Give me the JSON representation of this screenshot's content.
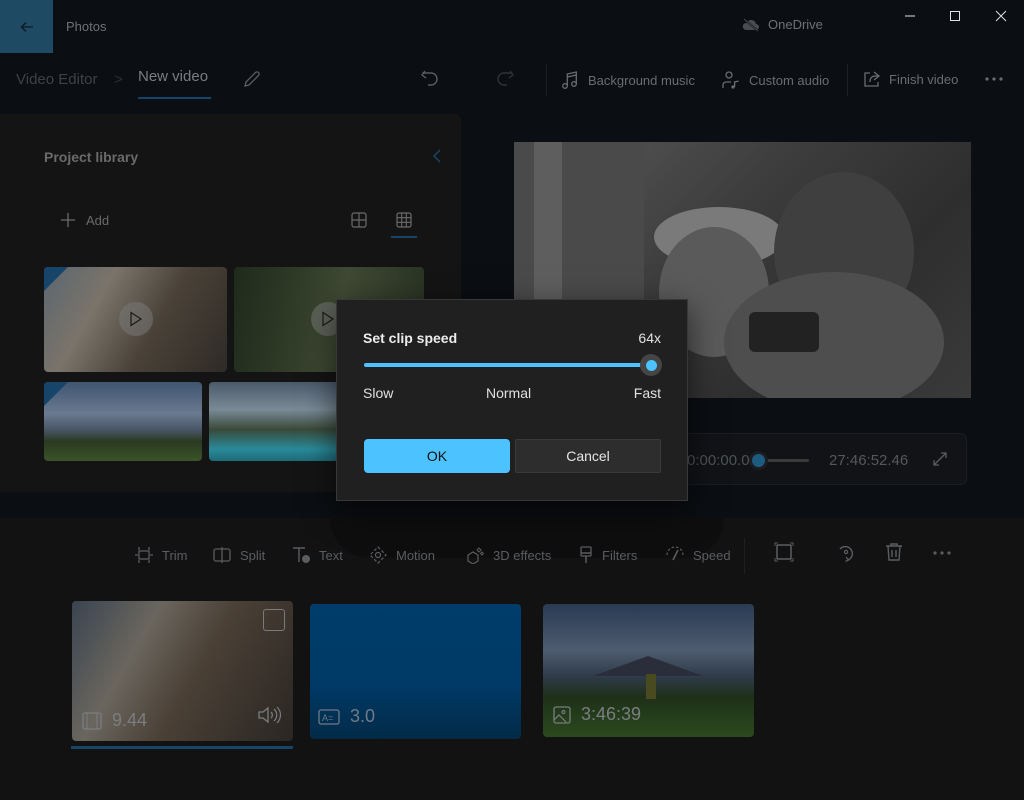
{
  "titlebar": {
    "app_title": "Photos",
    "back_icon": "arrow-left-icon",
    "onedrive_label": "OneDrive",
    "onedrive_icon": "cloud-offline-icon",
    "window_controls": [
      "minimize",
      "maximize",
      "close"
    ],
    "accent_color": "#1e4a63"
  },
  "breadcrumb": {
    "root": "Video Editor",
    "separator": ">",
    "current": "New video",
    "rename_icon": "pencil-icon"
  },
  "toolbar": {
    "undo_icon": "undo-icon",
    "redo_icon": "redo-icon",
    "buttons": [
      {
        "label": "Background music",
        "icon": "music-note-icon"
      },
      {
        "label": "Custom audio",
        "icon": "person-music-icon"
      },
      {
        "label": "Finish video",
        "icon": "share-icon"
      }
    ],
    "more_icon": "more-icon"
  },
  "library": {
    "title": "Project library",
    "add_label": "Add",
    "view_options": [
      "large-grid",
      "small-grid"
    ],
    "selected_view": "small-grid",
    "items": [
      {
        "type": "video",
        "subject": "couple-on-train",
        "in_timeline": true
      },
      {
        "type": "video",
        "subject": "forest",
        "in_timeline": false
      },
      {
        "type": "photo",
        "subject": "mountain-hiker",
        "in_timeline": true
      },
      {
        "type": "photo",
        "subject": "mountain-lake",
        "in_timeline": false
      }
    ]
  },
  "playback": {
    "current_time": "0:00:00.00",
    "total_time": "27:46:52.46",
    "progress": 0,
    "expand_icon": "expand-icon"
  },
  "edit_tools": [
    {
      "label": "Trim",
      "icon": "trim-icon"
    },
    {
      "label": "Split",
      "icon": "split-icon"
    },
    {
      "label": "Text",
      "icon": "text-icon"
    },
    {
      "label": "Motion",
      "icon": "motion-icon"
    },
    {
      "label": "3D effects",
      "icon": "3d-effects-icon"
    },
    {
      "label": "Filters",
      "icon": "filters-icon"
    },
    {
      "label": "Speed",
      "icon": "speed-icon"
    }
  ],
  "edit_icons": [
    "crop-icon",
    "rotate-icon",
    "delete-icon",
    "more-icon"
  ],
  "timeline": {
    "clips": [
      {
        "kind": "video",
        "duration": "9.44",
        "icon": "film-icon",
        "audio_icon": "volume-icon",
        "selected": true
      },
      {
        "kind": "title-card",
        "duration": "3.0",
        "icon": "title-card-icon",
        "color": "#003d6b"
      },
      {
        "kind": "photo",
        "duration": "3:46:39",
        "icon": "image-icon"
      }
    ]
  },
  "dialog": {
    "title": "Set clip speed",
    "value": "64x",
    "slider_fraction": 1.0,
    "labels": {
      "slow": "Slow",
      "normal": "Normal",
      "fast": "Fast"
    },
    "ok_label": "OK",
    "cancel_label": "Cancel",
    "accent_color": "#4cc2ff"
  }
}
